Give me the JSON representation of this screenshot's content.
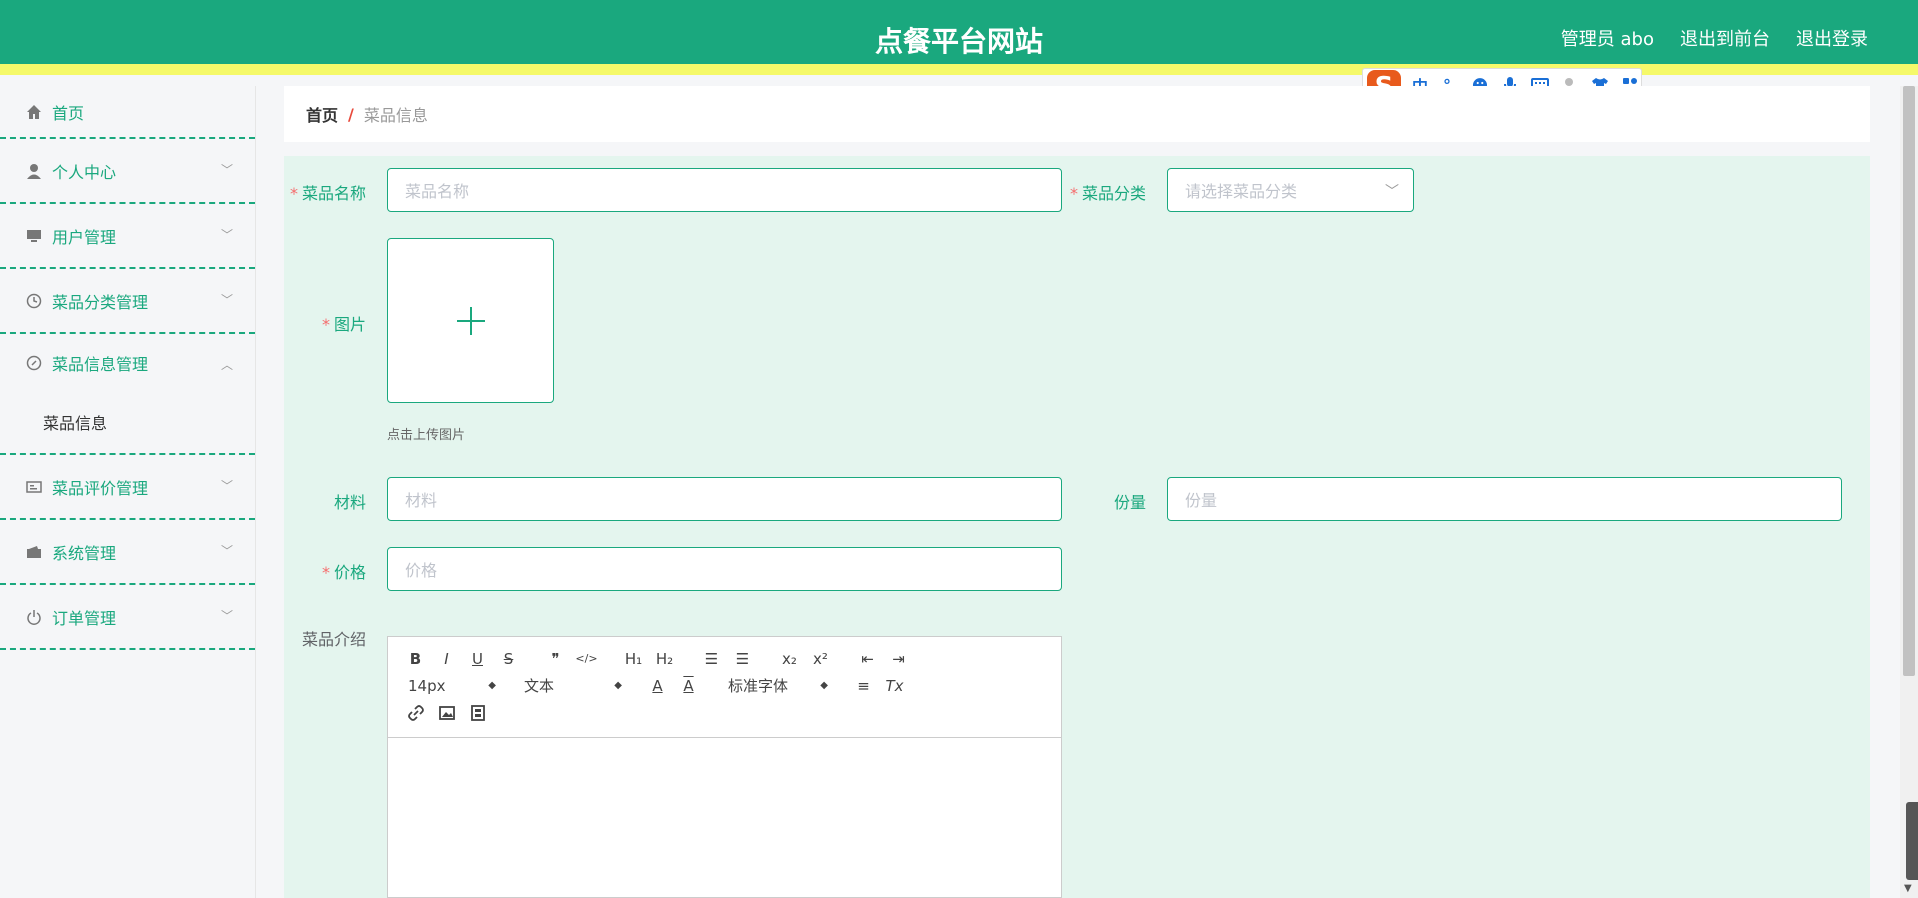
{
  "header": {
    "title": "点餐平台网站",
    "user": "管理员 abo",
    "links": [
      "退出到前台",
      "退出登录"
    ],
    "bg_color": "#1aa87e",
    "stripe_color": "#f5f96a"
  },
  "ime_toolbar": {
    "logo": "S",
    "icons": [
      "中",
      "°,",
      "☻",
      "mic-icon",
      "keyboard-icon",
      "person-icon",
      "shirt-icon",
      "apps-icon"
    ]
  },
  "sidebar": {
    "items": [
      {
        "label": "首页",
        "icon": "home-icon"
      },
      {
        "label": "个人中心",
        "icon": "person-icon"
      },
      {
        "label": "用户管理",
        "icon": "monitor-icon"
      },
      {
        "label": "菜品分类管理",
        "icon": "clock-icon"
      },
      {
        "label": "菜品信息管理",
        "icon": "compass-icon"
      },
      {
        "label": "菜品评价管理",
        "icon": "card-icon"
      },
      {
        "label": "系统管理",
        "icon": "wallet-icon"
      },
      {
        "label": "订单管理",
        "icon": "power-icon"
      }
    ],
    "submenu_item": "菜品信息"
  },
  "breadcrumb": {
    "home": "首页",
    "separator": "/",
    "current": "菜品信息"
  },
  "form": {
    "name": {
      "label": "菜品名称",
      "placeholder": "菜品名称",
      "required": true
    },
    "category": {
      "label": "菜品分类",
      "placeholder": "请选择菜品分类",
      "required": true
    },
    "image": {
      "label": "图片",
      "tip": "点击上传图片",
      "required": true
    },
    "material": {
      "label": "材料",
      "placeholder": "材料"
    },
    "portion": {
      "label": "份量",
      "placeholder": "份量"
    },
    "price": {
      "label": "价格",
      "placeholder": "价格",
      "required": true
    },
    "intro": {
      "label": "菜品介绍"
    }
  },
  "editor": {
    "font_size": "14px",
    "heading_select": "文本",
    "font_family": "标准字体",
    "buttons": {
      "bold": "B",
      "italic": "I",
      "underline": "U",
      "strike": "S",
      "quote": "❞",
      "code": "</>",
      "h1": "H₁",
      "h2": "H₂",
      "ol": "☰",
      "ul": "☰",
      "sub": "x₂",
      "sup": "x²",
      "outdent": "⇤",
      "indent": "⇥",
      "color": "A",
      "bg": "A",
      "align": "≡",
      "clean": "Tx",
      "link": "🔗",
      "image": "▣",
      "video": "▤"
    }
  },
  "required_mark": "*",
  "colors": {
    "accent": "#1aa87e",
    "required": "#f56c6c"
  }
}
